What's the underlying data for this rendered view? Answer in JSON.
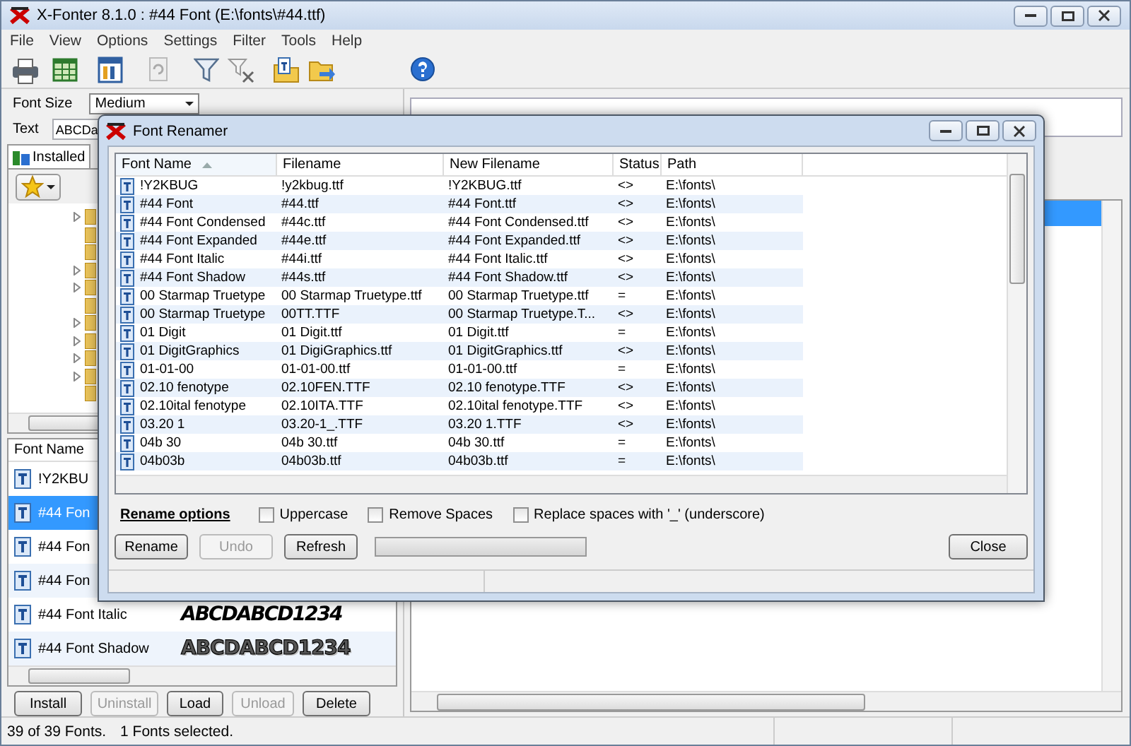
{
  "window": {
    "title": "X-Fonter 8.1.0  :  #44 Font (E:\\fonts\\#44.ttf)"
  },
  "menu": [
    "File",
    "View",
    "Options",
    "Settings",
    "Filter",
    "Tools",
    "Help"
  ],
  "left_panel": {
    "font_size": {
      "label": "Font Size",
      "value": "Medium"
    },
    "text": {
      "label": "Text",
      "value": "ABCDa"
    },
    "tabs": [
      {
        "label": "Installed",
        "selected": true
      }
    ],
    "font_list": {
      "column": "Font Name",
      "rows": [
        {
          "name": "!Y2KBU",
          "selected": false
        },
        {
          "name": "#44 Fon",
          "selected": true
        },
        {
          "name": "#44 Fon",
          "selected": false
        },
        {
          "name": "#44 Fon",
          "selected": false
        },
        {
          "name": "#44 Font Italic",
          "selected": false,
          "sample": "ABCDABCD1234",
          "kind": "italic"
        },
        {
          "name": "#44 Font Shadow",
          "selected": false,
          "sample": "ABCDABCD1234",
          "kind": "outline"
        }
      ]
    },
    "buttons": [
      {
        "label": "Install",
        "disabled": false
      },
      {
        "label": "Uninstall",
        "disabled": true
      },
      {
        "label": "Load",
        "disabled": false
      },
      {
        "label": "Unload",
        "disabled": true
      },
      {
        "label": "Delete",
        "disabled": false
      }
    ]
  },
  "font_renamer": {
    "title": "Font Renamer",
    "columns": [
      {
        "label": "Font Name",
        "sorted": true
      },
      {
        "label": "Filename",
        "sorted": false
      },
      {
        "label": "New Filename",
        "sorted": false
      },
      {
        "label": "Status",
        "sorted": false
      },
      {
        "label": "Path",
        "sorted": false
      }
    ],
    "rows": [
      {
        "font_name": "!Y2KBUG",
        "filename": "!y2kbug.ttf",
        "new_filename": "!Y2KBUG.ttf",
        "status": "<>",
        "path": "E:\\fonts\\"
      },
      {
        "font_name": "#44 Font",
        "filename": "#44.ttf",
        "new_filename": "#44 Font.ttf",
        "status": "<>",
        "path": "E:\\fonts\\"
      },
      {
        "font_name": "#44 Font Condensed",
        "filename": "#44c.ttf",
        "new_filename": "#44 Font Condensed.ttf",
        "status": "<>",
        "path": "E:\\fonts\\"
      },
      {
        "font_name": "#44 Font Expanded",
        "filename": "#44e.ttf",
        "new_filename": "#44 Font Expanded.ttf",
        "status": "<>",
        "path": "E:\\fonts\\"
      },
      {
        "font_name": "#44 Font Italic",
        "filename": "#44i.ttf",
        "new_filename": "#44 Font Italic.ttf",
        "status": "<>",
        "path": "E:\\fonts\\"
      },
      {
        "font_name": "#44 Font Shadow",
        "filename": "#44s.ttf",
        "new_filename": "#44 Font Shadow.ttf",
        "status": "<>",
        "path": "E:\\fonts\\"
      },
      {
        "font_name": "00 Starmap Truetype",
        "filename": "00 Starmap Truetype.ttf",
        "new_filename": "00 Starmap Truetype.ttf",
        "status": "=",
        "path": "E:\\fonts\\"
      },
      {
        "font_name": "00 Starmap Truetype",
        "filename": "00TT.TTF",
        "new_filename": "00 Starmap Truetype.T...",
        "status": "<>",
        "path": "E:\\fonts\\"
      },
      {
        "font_name": "01 Digit",
        "filename": "01 Digit.ttf",
        "new_filename": "01 Digit.ttf",
        "status": "=",
        "path": "E:\\fonts\\"
      },
      {
        "font_name": "01 DigitGraphics",
        "filename": "01 DigiGraphics.ttf",
        "new_filename": "01 DigitGraphics.ttf",
        "status": "<>",
        "path": "E:\\fonts\\"
      },
      {
        "font_name": "01-01-00",
        "filename": "01-01-00.ttf",
        "new_filename": "01-01-00.ttf",
        "status": "=",
        "path": "E:\\fonts\\"
      },
      {
        "font_name": "02.10 fenotype",
        "filename": "02.10FEN.TTF",
        "new_filename": "02.10 fenotype.TTF",
        "status": "<>",
        "path": "E:\\fonts\\"
      },
      {
        "font_name": "02.10ital fenotype",
        "filename": "02.10ITA.TTF",
        "new_filename": "02.10ital fenotype.TTF",
        "status": "<>",
        "path": "E:\\fonts\\"
      },
      {
        "font_name": "03.20 1",
        "filename": "03.20-1_.TTF",
        "new_filename": "03.20 1.TTF",
        "status": "<>",
        "path": "E:\\fonts\\"
      },
      {
        "font_name": "04b 30",
        "filename": "04b 30.ttf",
        "new_filename": "04b 30.ttf",
        "status": "=",
        "path": "E:\\fonts\\"
      },
      {
        "font_name": "04b03b",
        "filename": "04b03b.ttf",
        "new_filename": "04b03b.ttf",
        "status": "=",
        "path": "E:\\fonts\\"
      }
    ],
    "options_label": "Rename options",
    "checkboxes": [
      {
        "label": "Uppercase",
        "checked": false
      },
      {
        "label": "Remove Spaces",
        "checked": false
      },
      {
        "label": "Replace spaces with '_' (underscore)",
        "checked": false
      }
    ],
    "buttons": [
      {
        "label": "Rename",
        "disabled": false
      },
      {
        "label": "Undo",
        "disabled": true
      },
      {
        "label": "Refresh",
        "disabled": false
      }
    ],
    "progress": {
      "level": 0
    },
    "close_button": "Close"
  },
  "status_bar": [
    "39 of 39 Fonts.",
    "1 Fonts selected."
  ]
}
